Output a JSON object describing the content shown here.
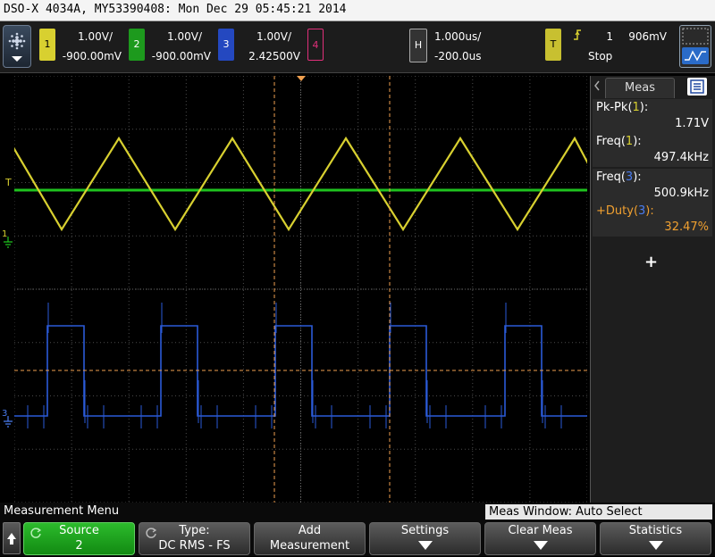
{
  "title": "DSO-X 4034A, MY53390408: Mon Dec 29 05:45:21 2014",
  "channels": [
    {
      "num": "1",
      "volts": "1.00V/",
      "offset": "-900.00mV",
      "color": "#d8d030",
      "active": true
    },
    {
      "num": "2",
      "volts": "1.00V/",
      "offset": "-900.00mV",
      "color": "#1fc21f",
      "active": true
    },
    {
      "num": "3",
      "volts": "1.00V/",
      "offset": "2.42500V",
      "color": "#2a5ad8",
      "active": true
    },
    {
      "num": "4",
      "volts": "",
      "offset": "",
      "color": "#e0307a",
      "active": false
    }
  ],
  "horizontal": {
    "label": "H",
    "scale": "1.000us/",
    "delay": "-200.0us"
  },
  "trigger": {
    "label": "T",
    "source": "1",
    "level": "906mV",
    "status": "Stop"
  },
  "markers": {
    "ch1": "1",
    "ch3": "3",
    "trigger": "T"
  },
  "meas_panel": {
    "tab": "Meas",
    "items": [
      {
        "name": "Pk-Pk",
        "src": "1",
        "value": "1.71V",
        "color": "#ffffff",
        "src_color": "#d8d030"
      },
      {
        "name": "Freq",
        "src": "1",
        "value": "497.4kHz",
        "color": "#ffffff",
        "src_color": "#d8d030"
      },
      {
        "name": "Freq",
        "src": "3",
        "value": "500.9kHz",
        "color": "#ffffff",
        "src_color": "#4a7cf0"
      },
      {
        "name": "+Duty",
        "src": "3",
        "value": "32.47%",
        "color": "#f0a030",
        "src_color": "#4a7cf0"
      }
    ],
    "add": "+"
  },
  "menu": {
    "title": "Measurement Menu",
    "window": "Meas Window: Auto Select",
    "softkeys": [
      {
        "line1": "Source",
        "line2": "2"
      },
      {
        "line1": "Type:",
        "line2": "DC RMS - FS"
      },
      {
        "line1": "Add",
        "line2": "Measurement"
      },
      {
        "line1": "Settings",
        "line2": ""
      },
      {
        "line1": "Clear Meas",
        "line2": ""
      },
      {
        "line1": "Statistics",
        "line2": ""
      }
    ]
  }
}
